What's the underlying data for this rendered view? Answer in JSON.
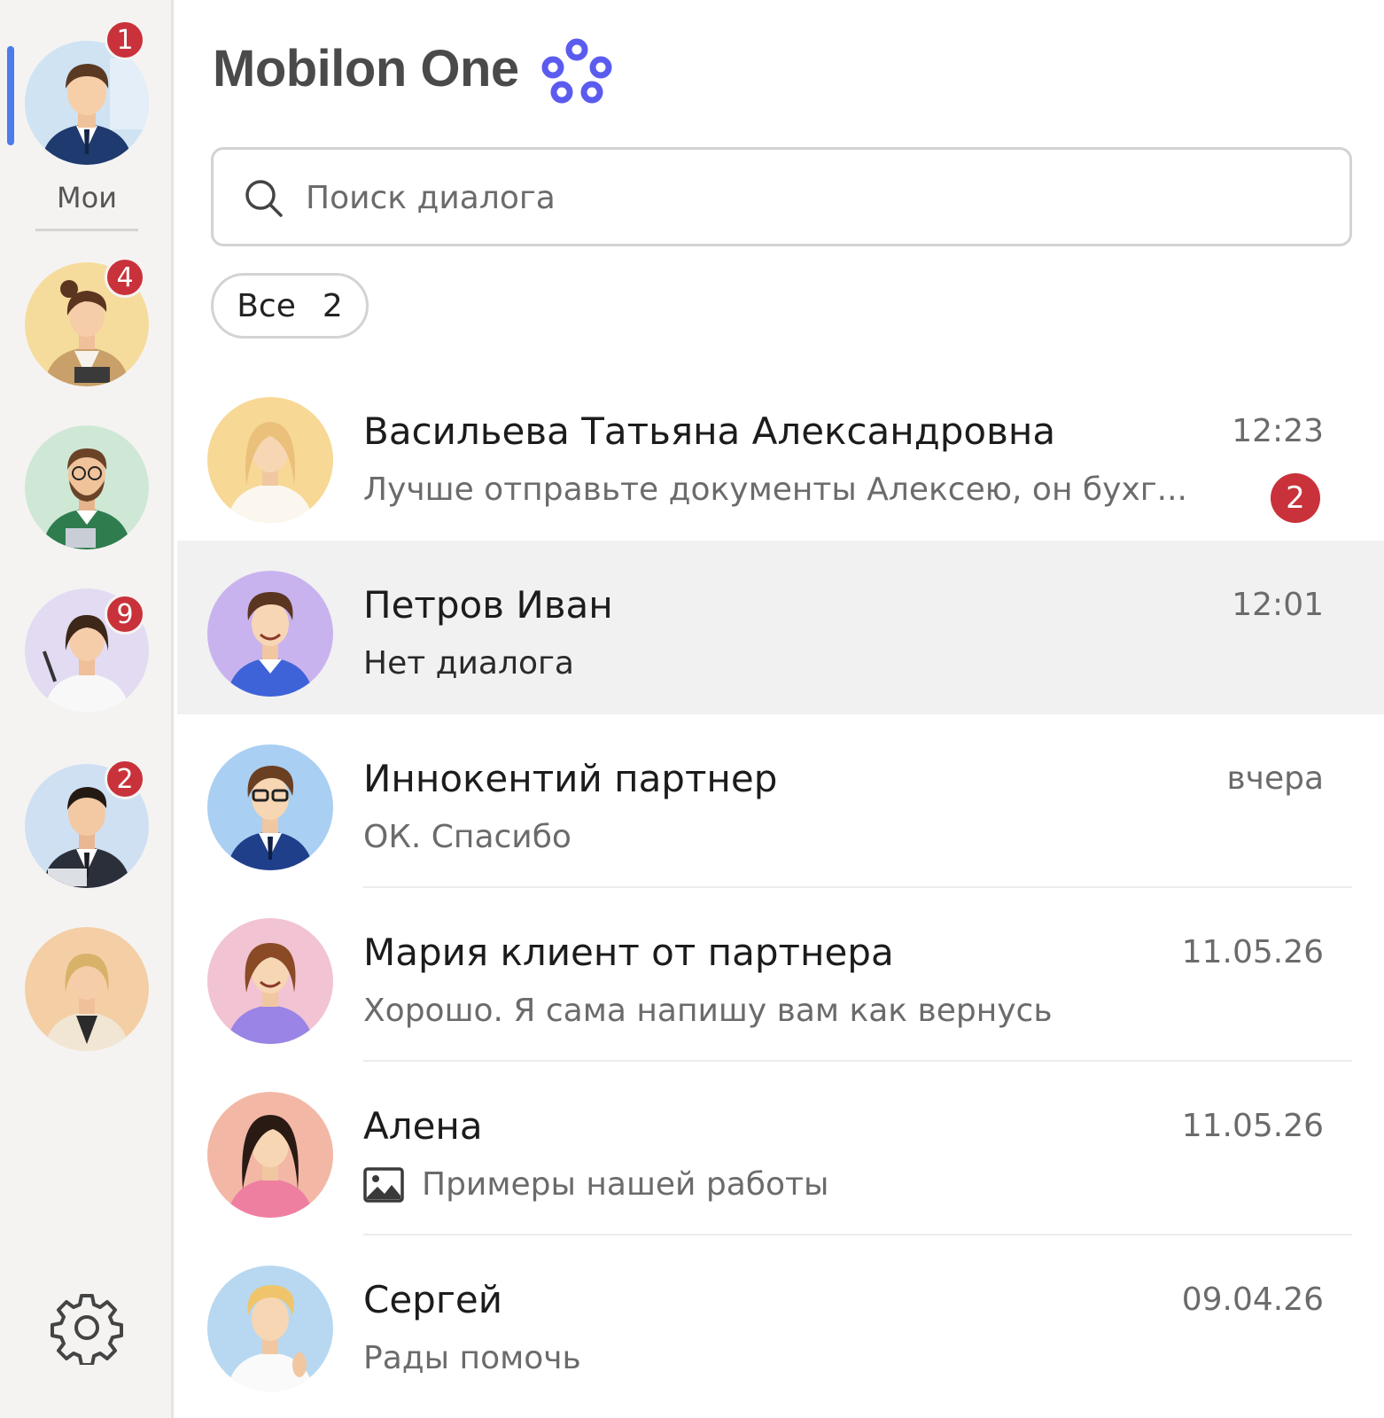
{
  "app": {
    "title": "Mobilon One",
    "accent": "#5b5bf0"
  },
  "rail": {
    "label": "Мои",
    "accounts": [
      {
        "id": "acc1",
        "badge": "1",
        "active": true
      },
      {
        "id": "acc2",
        "badge": "4"
      },
      {
        "id": "acc3",
        "badge": ""
      },
      {
        "id": "acc4",
        "badge": "9"
      },
      {
        "id": "acc5",
        "badge": "2"
      },
      {
        "id": "acc6",
        "badge": ""
      }
    ],
    "settings_icon": "gear-icon"
  },
  "search": {
    "placeholder": "Поиск диалога",
    "value": ""
  },
  "filter": {
    "label": "Все",
    "count": "2"
  },
  "dialogs": [
    {
      "name": "Васильева Татьяна Александровна",
      "message": "Лучше отправьте документы Алексею, он бухг...",
      "time": "12:23",
      "unread": "2"
    },
    {
      "name": "Петров Иван",
      "message": "Нет диалога",
      "time": "12:01",
      "selected": true
    },
    {
      "name": "Иннокентий партнер",
      "message": "ОК. Спасибо",
      "time": "вчера"
    },
    {
      "name": "Мария клиент от партнера",
      "message": "Хорошо. Я сама напишу вам как вернусь",
      "time": "11.05.26"
    },
    {
      "name": "Алена",
      "message": "Примеры нашей работы",
      "time": "11.05.26",
      "attachment_icon": "image-icon"
    },
    {
      "name": "Сергей",
      "message": "Рады помочь",
      "time": "09.04.26"
    }
  ],
  "colors": {
    "badge": "#c9323a",
    "active_indicator": "#4b7bec",
    "selected_row": "#f1f1f1"
  }
}
